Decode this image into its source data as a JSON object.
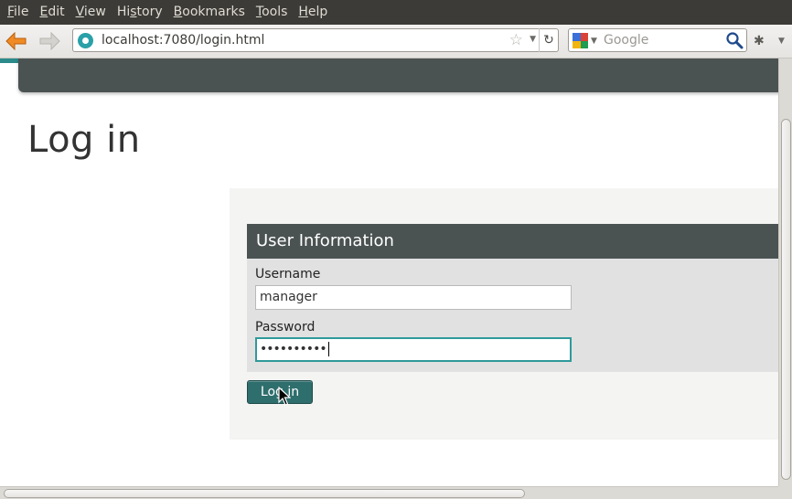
{
  "menubar": {
    "items": [
      {
        "pre": "",
        "u": "F",
        "post": "ile"
      },
      {
        "pre": "",
        "u": "E",
        "post": "dit"
      },
      {
        "pre": "",
        "u": "V",
        "post": "iew"
      },
      {
        "pre": "Hi",
        "u": "s",
        "post": "tory"
      },
      {
        "pre": "",
        "u": "B",
        "post": "ookmarks"
      },
      {
        "pre": "",
        "u": "T",
        "post": "ools"
      },
      {
        "pre": "",
        "u": "H",
        "post": "elp"
      }
    ]
  },
  "toolbar": {
    "url": "localhost:7080/login.html",
    "search_placeholder": "Google"
  },
  "page": {
    "title": "Log in",
    "fieldset_legend": "User Information",
    "username_label": "Username",
    "username_value": "manager",
    "password_label": "Password",
    "password_value": "••••••••••",
    "login_button": "Log in"
  },
  "colors": {
    "accent": "#2b8a8a",
    "header": "#4b5352",
    "button": "#2e6e6d"
  }
}
